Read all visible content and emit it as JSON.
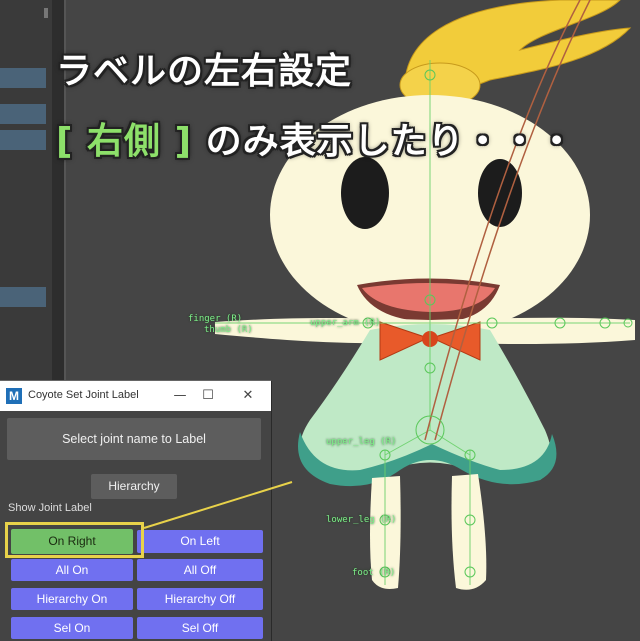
{
  "caption": {
    "line1": "ラベルの左右設定",
    "bracket_open": "[",
    "bracket_word": "右側",
    "bracket_close": "]",
    "line2_rest": "のみ表示したり・・・"
  },
  "joint_labels": {
    "finger": "finger (R)",
    "thumb": "thumb (R)",
    "upper_arm": "upper_arm (R)",
    "upper_leg": "upper_leg (R)",
    "lower_leg": "lower_leg (R)",
    "foot": "foot (R)"
  },
  "window": {
    "icon_letter": "M",
    "title": "Coyote Set Joint Label",
    "minimize_glyph": "—",
    "maximize_glyph": "☐",
    "close_glyph": "✕"
  },
  "panel": {
    "select_button": "Select joint name to Label",
    "hierarchy_button": "Hierarchy",
    "show_label": "Show Joint Label",
    "on_right": "On Right",
    "on_left": "On Left",
    "all_on": "All On",
    "all_off": "All Off",
    "hierarchy_on": "Hierarchy On",
    "hierarchy_off": "Hierarchy Off",
    "sel_on": "Sel On",
    "sel_off": "Sel Off"
  },
  "colors": {
    "on_right_active": "#72c068",
    "toggle_blue": "#7070f0",
    "highlight": "#e8d24a",
    "joint_label_green": "#7ef08a"
  }
}
